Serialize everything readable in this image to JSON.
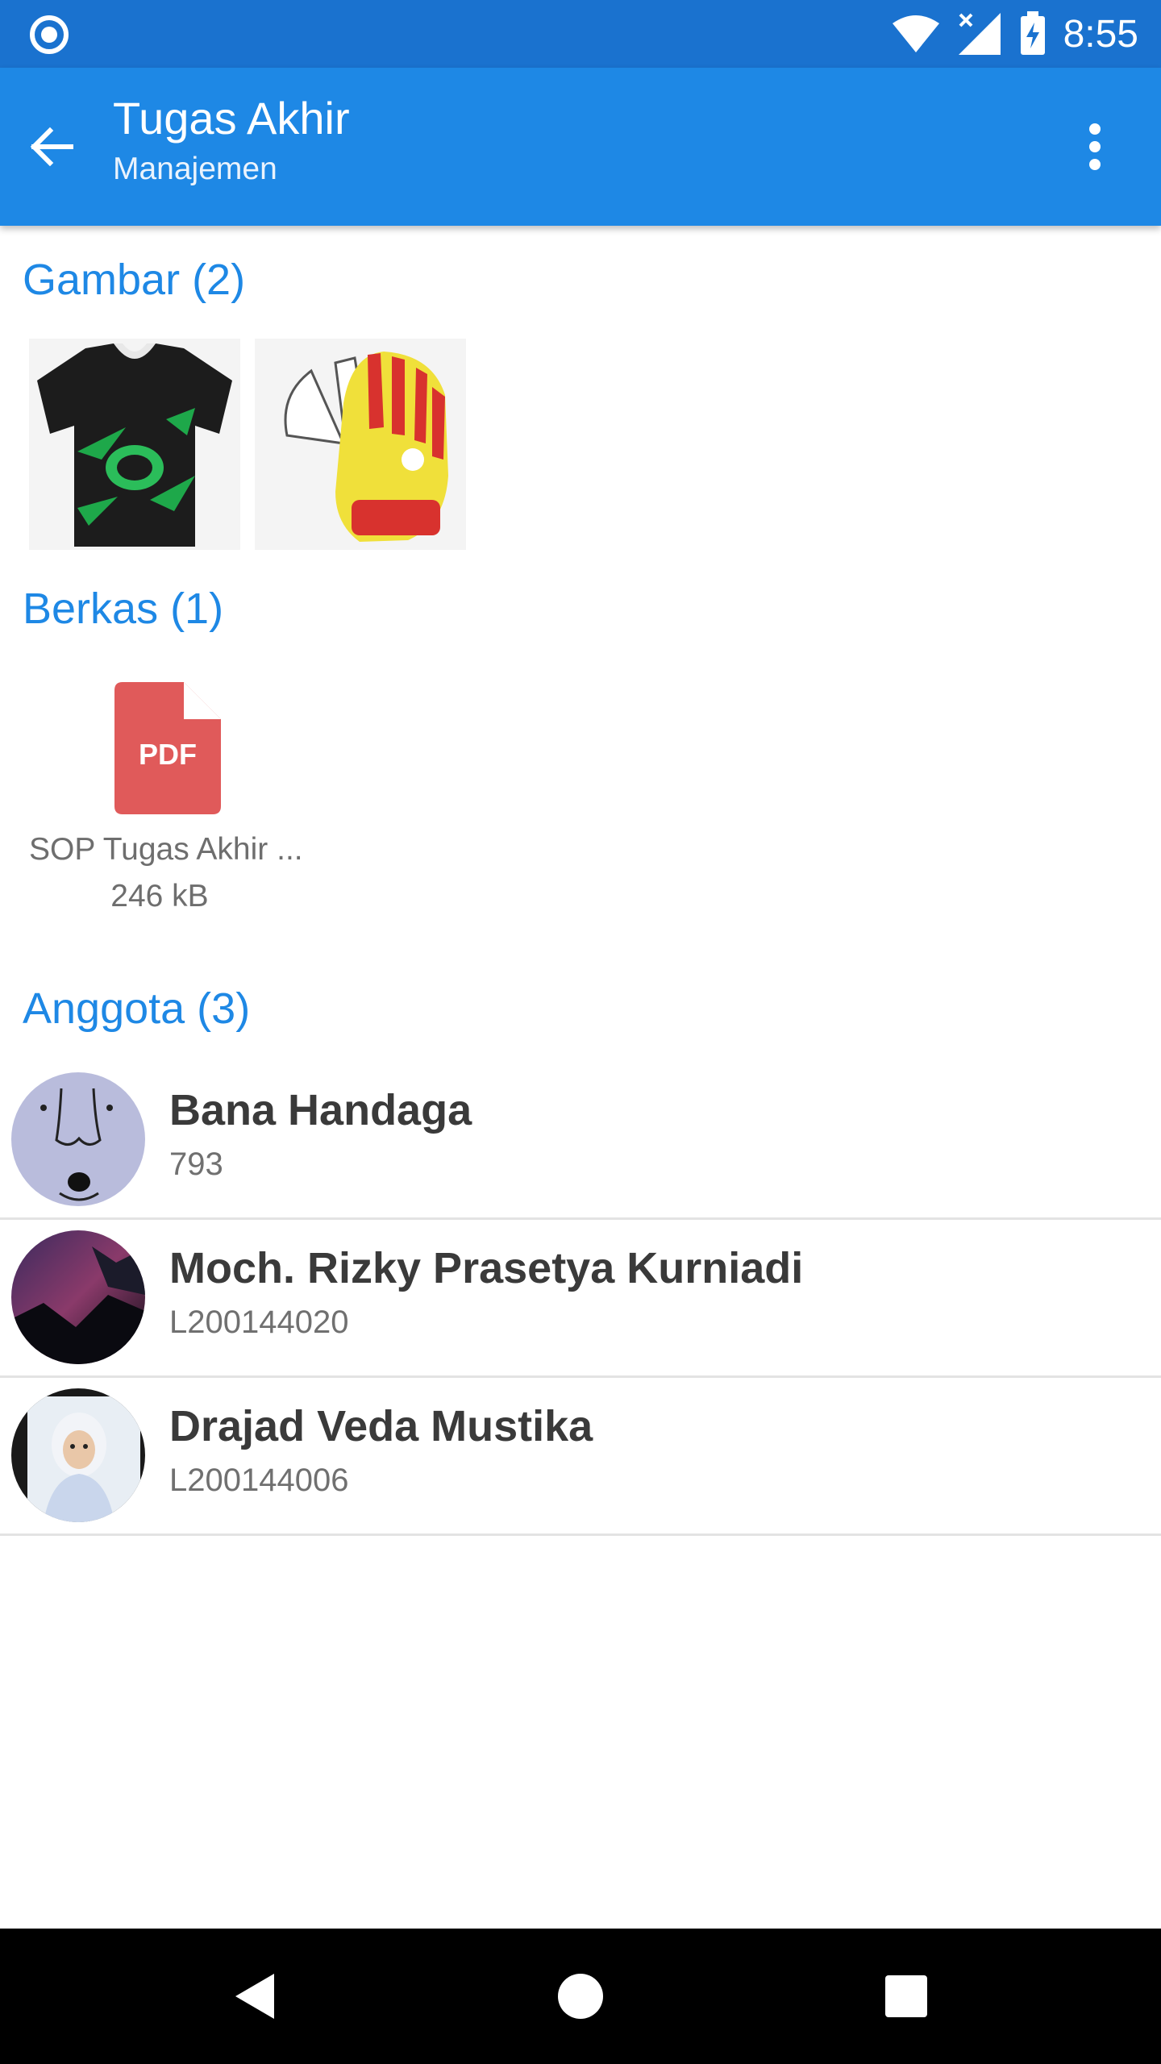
{
  "status_bar": {
    "time": "8:55",
    "icons": [
      "notification-circle-icon",
      "wifi-icon",
      "cell-signal-icon",
      "battery-charging-icon"
    ]
  },
  "app_bar": {
    "title": "Tugas Akhir",
    "subtitle": "Manajemen",
    "icons": [
      "arrow-back-icon",
      "more-vert-icon"
    ]
  },
  "images_section": {
    "title": "Gambar (2)",
    "items": [
      {
        "icon": "jersey-image"
      },
      {
        "icon": "goalkeeper-glove-image"
      }
    ]
  },
  "files_section": {
    "title": "Berkas (1)",
    "items": [
      {
        "icon_label": "PDF",
        "name": "SOP Tugas Akhir ...",
        "size": "246 kB"
      }
    ]
  },
  "members_section": {
    "title": "Anggota (3)",
    "members": [
      {
        "name": "Bana Handaga",
        "id": "793"
      },
      {
        "name": "Moch. Rizky Prasetya Kurniadi",
        "id": "L200144020"
      },
      {
        "name": "Drajad Veda Mustika",
        "id": "L200144006"
      }
    ]
  },
  "nav_bar": {
    "icons": [
      "nav-back-icon",
      "nav-home-icon",
      "nav-recents-icon"
    ]
  },
  "colors": {
    "status_bar": "#1a72cf",
    "app_bar": "#1e88e5",
    "section_title": "#1e88e5",
    "pdf": "#e05a5a"
  }
}
